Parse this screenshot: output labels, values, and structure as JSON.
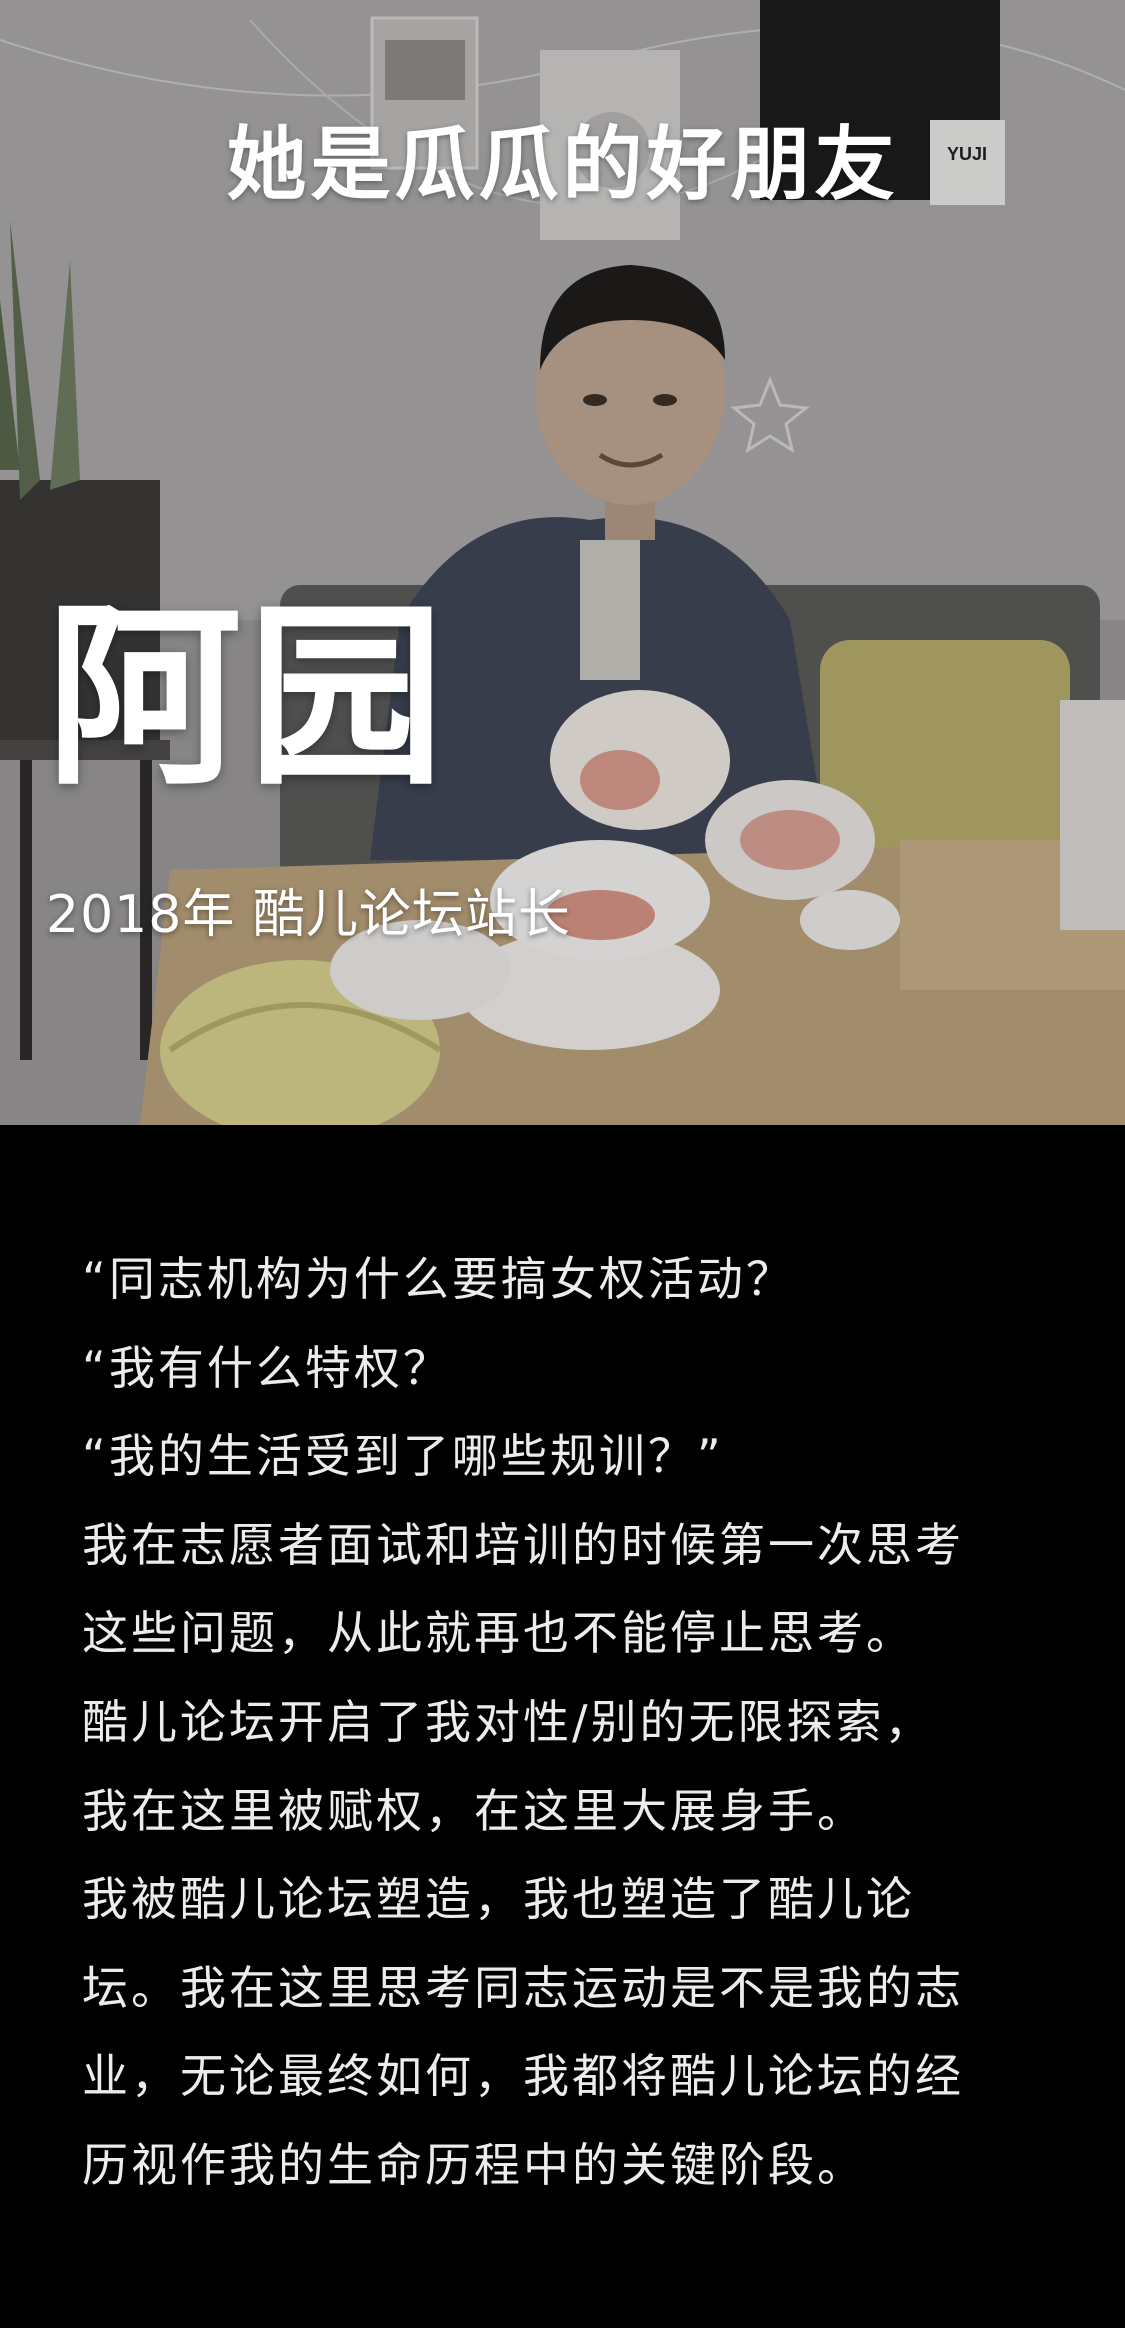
{
  "header": {
    "headline": "她是瓜瓜的好朋友"
  },
  "profile": {
    "name": "阿园",
    "title": "2018年 酷儿论坛站长"
  },
  "photo": {
    "cafe_sign": "YUJI"
  },
  "body": {
    "lines": [
      "“同志机构为什么要搞女权活动？",
      "“我有什么特权？",
      "“我的生活受到了哪些规训？”",
      "我在志愿者面试和培训的时候第一次思考",
      "这些问题，从此就再也不能停止思考。",
      "酷儿论坛开启了我对性/别的无限探索，",
      "我在这里被赋权，在这里大展身手。",
      "我被酷儿论坛塑造，我也塑造了酷儿论",
      "坛。我在这里思考同志运动是不是我的志",
      "业，无论最终如何，我都将酷儿论坛的经",
      "历视作我的生命历程中的关键阶段。"
    ]
  },
  "colors": {
    "background": "#000000",
    "text": "#ececec",
    "overlay_text": "#ffffff"
  }
}
